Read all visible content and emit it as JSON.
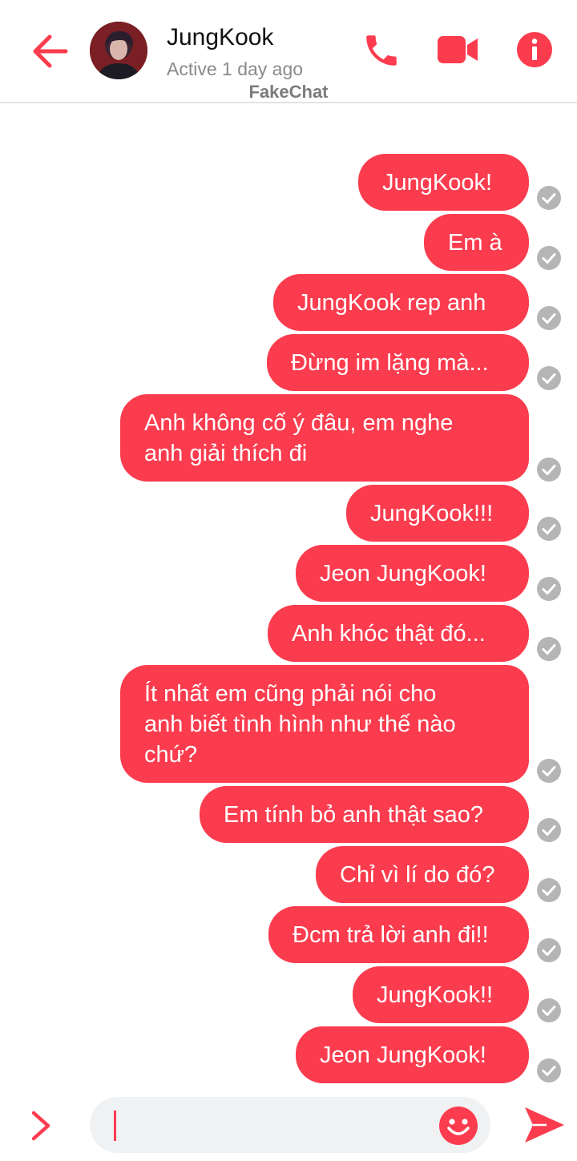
{
  "header": {
    "name": "JungKook",
    "status": "Active 1 day ago",
    "watermark": "FakeChat"
  },
  "theme": {
    "accent": "#fb3c4e",
    "check_color": "#b5b5b5"
  },
  "icons": {
    "back": "arrow-left-icon",
    "call": "phone-icon",
    "video": "video-camera-icon",
    "info": "info-icon",
    "expand": "chevron-right-icon",
    "emoji": "smiley-icon",
    "send": "send-icon"
  },
  "messages": [
    {
      "text": "JungKook!",
      "status": "sent"
    },
    {
      "text": "Em à",
      "status": "sent"
    },
    {
      "text": "JungKook rep anh",
      "status": "sent"
    },
    {
      "text": "Đừng im lặng mà...",
      "status": "sent"
    },
    {
      "text": "Anh không cố ý đâu, em nghe\nanh giải thích đi",
      "status": "sent"
    },
    {
      "text": "JungKook!!!",
      "status": "sent"
    },
    {
      "text": "Jeon JungKook!",
      "status": "sent"
    },
    {
      "text": "Anh khóc thật đó...",
      "status": "sent"
    },
    {
      "text": "Ít nhất em cũng phải nói cho\nanh biết tình hình như thế nào\nchứ?",
      "status": "sent"
    },
    {
      "text": "Em tính bỏ anh thật sao?",
      "status": "sent"
    },
    {
      "text": "Chỉ vì lí do đó?",
      "status": "sent"
    },
    {
      "text": "Đcm trả lời anh đi!!",
      "status": "sent"
    },
    {
      "text": "JungKook!!",
      "status": "sent"
    },
    {
      "text": "Jeon JungKook!",
      "status": "sent"
    }
  ],
  "composer": {
    "value": "",
    "placeholder": ""
  }
}
